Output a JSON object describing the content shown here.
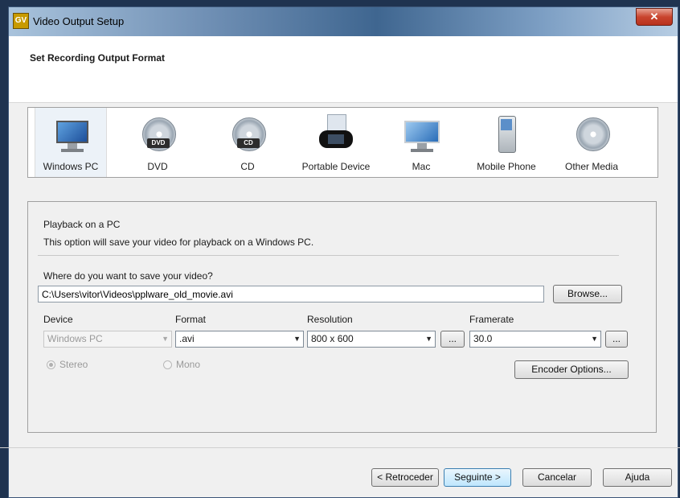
{
  "window": {
    "title": "Video Output Setup",
    "app_icon_text": "GV",
    "close_glyph": "✕"
  },
  "header": {
    "title": "Set Recording Output Format"
  },
  "formats": [
    {
      "label": "Windows PC",
      "icon": "windows-pc-icon",
      "selected": true
    },
    {
      "label": "DVD",
      "icon": "dvd-icon",
      "badge": "DVD"
    },
    {
      "label": "CD",
      "icon": "cd-icon",
      "badge": "CD"
    },
    {
      "label": "Portable Device",
      "icon": "portable-device-icon",
      "badge": "PSP"
    },
    {
      "label": "Mac",
      "icon": "mac-icon"
    },
    {
      "label": "Mobile Phone",
      "icon": "mobile-phone-icon"
    },
    {
      "label": "Other Media",
      "icon": "other-media-icon"
    }
  ],
  "panel": {
    "heading": "Playback on a PC",
    "description": "This option will save your video for playback on a Windows PC.",
    "save_question": "Where do you want to save your video?",
    "save_path": "C:\\Users\\vitor\\Videos\\pplware_old_movie.avi",
    "browse_label": "Browse...",
    "labels": {
      "device": "Device",
      "format": "Format",
      "resolution": "Resolution",
      "framerate": "Framerate"
    },
    "device_value": "Windows PC",
    "format_value": ".avi",
    "resolution_value": "800 x 600",
    "framerate_value": "30.0",
    "ellipsis": "...",
    "stereo_label": "Stereo",
    "mono_label": "Mono",
    "encoder_options_label": "Encoder Options..."
  },
  "footer": {
    "back_label": "< Retroceder",
    "next_label": "Seguinte >",
    "cancel_label": "Cancelar",
    "help_label": "Ajuda"
  }
}
